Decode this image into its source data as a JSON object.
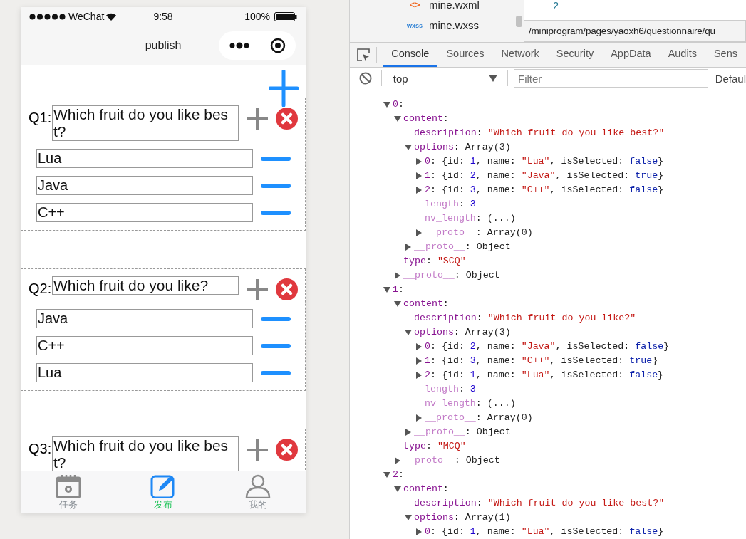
{
  "phone": {
    "status_bar": {
      "carrier": "WeChat",
      "time": "9:58",
      "battery": "100%"
    },
    "nav_title": "publish",
    "questions": [
      {
        "label": "Q1:",
        "description": "Which fruit do you like best?",
        "options": [
          "Lua",
          "Java",
          "C++"
        ]
      },
      {
        "label": "Q2:",
        "description": "Which fruit do you like?",
        "options": [
          "Java",
          "C++",
          "Lua"
        ]
      },
      {
        "label": "Q3:",
        "description": "Which fruit do you like best?"
      }
    ],
    "tab_bar": [
      {
        "kind": "tasks",
        "label": "任务",
        "selected": false
      },
      {
        "kind": "publish",
        "label": "发布",
        "selected": true
      },
      {
        "kind": "profile",
        "label": "我的",
        "selected": false
      }
    ]
  },
  "devtools": {
    "files": [
      {
        "kind": "wxml",
        "badge": "<>",
        "name": "mine.wxml"
      },
      {
        "kind": "wxss",
        "badge": "wxss",
        "name": "mine.wxss"
      }
    ],
    "editor_line_number": "2",
    "tooltip": "/miniprogram/pages/yaoxh6/questionnaire/qu",
    "tabs": [
      {
        "label": "Console",
        "selected": true
      },
      {
        "label": "Sources",
        "selected": false
      },
      {
        "label": "Network",
        "selected": false
      },
      {
        "label": "Security",
        "selected": false
      },
      {
        "label": "AppData",
        "selected": false
      },
      {
        "label": "Audits",
        "selected": false
      },
      {
        "label": "Sens",
        "selected": false
      }
    ],
    "context": "top",
    "filter": {
      "placeholder": "Filter"
    },
    "levels": "Defaul",
    "console": [
      {
        "kind": "toggle",
        "expanded": true,
        "tokens": [
          {
            "kind": "key",
            "text": "0"
          },
          {
            "kind": "plain",
            "text": ":"
          }
        ],
        "children": [
          {
            "kind": "toggle",
            "expanded": true,
            "tokens": [
              {
                "kind": "key",
                "text": "content"
              },
              {
                "kind": "plain",
                "text": ":"
              }
            ],
            "children": [
              {
                "kind": "leaf",
                "tokens": [
                  {
                    "kind": "key",
                    "text": "description"
                  },
                  {
                    "kind": "plain",
                    "text": ": "
                  },
                  {
                    "kind": "string",
                    "text": "\"Which fruit do you like best?\""
                  }
                ]
              },
              {
                "kind": "toggle",
                "expanded": true,
                "tokens": [
                  {
                    "kind": "key",
                    "text": "options"
                  },
                  {
                    "kind": "plain",
                    "text": ": Array(3)"
                  }
                ],
                "children": [
                  {
                    "kind": "toggle",
                    "expanded": false,
                    "tokens": [
                      {
                        "kind": "key",
                        "text": "0"
                      },
                      {
                        "kind": "plain",
                        "text": ": {id: "
                      },
                      {
                        "kind": "number",
                        "text": "1"
                      },
                      {
                        "kind": "plain",
                        "text": ", name: "
                      },
                      {
                        "kind": "string",
                        "text": "\"Lua\""
                      },
                      {
                        "kind": "plain",
                        "text": ", isSelected: "
                      },
                      {
                        "kind": "bool",
                        "text": "false"
                      },
                      {
                        "kind": "plain",
                        "text": "}"
                      }
                    ]
                  },
                  {
                    "kind": "toggle",
                    "expanded": false,
                    "tokens": [
                      {
                        "kind": "key",
                        "text": "1"
                      },
                      {
                        "kind": "plain",
                        "text": ": {id: "
                      },
                      {
                        "kind": "number",
                        "text": "2"
                      },
                      {
                        "kind": "plain",
                        "text": ", name: "
                      },
                      {
                        "kind": "string",
                        "text": "\"Java\""
                      },
                      {
                        "kind": "plain",
                        "text": ", isSelected: "
                      },
                      {
                        "kind": "bool",
                        "text": "true"
                      },
                      {
                        "kind": "plain",
                        "text": "}"
                      }
                    ]
                  },
                  {
                    "kind": "toggle",
                    "expanded": false,
                    "tokens": [
                      {
                        "kind": "key",
                        "text": "2"
                      },
                      {
                        "kind": "plain",
                        "text": ": {id: "
                      },
                      {
                        "kind": "number",
                        "text": "3"
                      },
                      {
                        "kind": "plain",
                        "text": ", name: "
                      },
                      {
                        "kind": "string",
                        "text": "\"C++\""
                      },
                      {
                        "kind": "plain",
                        "text": ", isSelected: "
                      },
                      {
                        "kind": "bool",
                        "text": "false"
                      },
                      {
                        "kind": "plain",
                        "text": "}"
                      }
                    ]
                  },
                  {
                    "kind": "leaf",
                    "tokens": [
                      {
                        "kind": "dim",
                        "text": "length"
                      },
                      {
                        "kind": "plain",
                        "text": ": "
                      },
                      {
                        "kind": "number",
                        "text": "3"
                      }
                    ]
                  },
                  {
                    "kind": "leaf",
                    "tokens": [
                      {
                        "kind": "dim",
                        "text": "nv_length"
                      },
                      {
                        "kind": "plain",
                        "text": ": (...)"
                      }
                    ]
                  },
                  {
                    "kind": "toggle",
                    "expanded": false,
                    "tokens": [
                      {
                        "kind": "dim",
                        "text": "__proto__"
                      },
                      {
                        "kind": "plain",
                        "text": ": Array(0)"
                      }
                    ]
                  }
                ]
              },
              {
                "kind": "toggle",
                "expanded": false,
                "tokens": [
                  {
                    "kind": "dim",
                    "text": "__proto__"
                  },
                  {
                    "kind": "plain",
                    "text": ": Object"
                  }
                ]
              }
            ]
          },
          {
            "kind": "leaf",
            "tokens": [
              {
                "kind": "key",
                "text": "type"
              },
              {
                "kind": "plain",
                "text": ": "
              },
              {
                "kind": "string",
                "text": "\"SCQ\""
              }
            ]
          },
          {
            "kind": "toggle",
            "expanded": false,
            "tokens": [
              {
                "kind": "dim",
                "text": "__proto__"
              },
              {
                "kind": "plain",
                "text": ": Object"
              }
            ]
          }
        ]
      },
      {
        "kind": "toggle",
        "expanded": true,
        "tokens": [
          {
            "kind": "key",
            "text": "1"
          },
          {
            "kind": "plain",
            "text": ":"
          }
        ],
        "children": [
          {
            "kind": "toggle",
            "expanded": true,
            "tokens": [
              {
                "kind": "key",
                "text": "content"
              },
              {
                "kind": "plain",
                "text": ":"
              }
            ],
            "children": [
              {
                "kind": "leaf",
                "tokens": [
                  {
                    "kind": "key",
                    "text": "description"
                  },
                  {
                    "kind": "plain",
                    "text": ": "
                  },
                  {
                    "kind": "string",
                    "text": "\"Which fruit do you like?\""
                  }
                ]
              },
              {
                "kind": "toggle",
                "expanded": true,
                "tokens": [
                  {
                    "kind": "key",
                    "text": "options"
                  },
                  {
                    "kind": "plain",
                    "text": ": Array(3)"
                  }
                ],
                "children": [
                  {
                    "kind": "toggle",
                    "expanded": false,
                    "tokens": [
                      {
                        "kind": "key",
                        "text": "0"
                      },
                      {
                        "kind": "plain",
                        "text": ": {id: "
                      },
                      {
                        "kind": "number",
                        "text": "2"
                      },
                      {
                        "kind": "plain",
                        "text": ", name: "
                      },
                      {
                        "kind": "string",
                        "text": "\"Java\""
                      },
                      {
                        "kind": "plain",
                        "text": ", isSelected: "
                      },
                      {
                        "kind": "bool",
                        "text": "false"
                      },
                      {
                        "kind": "plain",
                        "text": "}"
                      }
                    ]
                  },
                  {
                    "kind": "toggle",
                    "expanded": false,
                    "tokens": [
                      {
                        "kind": "key",
                        "text": "1"
                      },
                      {
                        "kind": "plain",
                        "text": ": {id: "
                      },
                      {
                        "kind": "number",
                        "text": "3"
                      },
                      {
                        "kind": "plain",
                        "text": ", name: "
                      },
                      {
                        "kind": "string",
                        "text": "\"C++\""
                      },
                      {
                        "kind": "plain",
                        "text": ", isSelected: "
                      },
                      {
                        "kind": "bool",
                        "text": "true"
                      },
                      {
                        "kind": "plain",
                        "text": "}"
                      }
                    ]
                  },
                  {
                    "kind": "toggle",
                    "expanded": false,
                    "tokens": [
                      {
                        "kind": "key",
                        "text": "2"
                      },
                      {
                        "kind": "plain",
                        "text": ": {id: "
                      },
                      {
                        "kind": "number",
                        "text": "1"
                      },
                      {
                        "kind": "plain",
                        "text": ", name: "
                      },
                      {
                        "kind": "string",
                        "text": "\"Lua\""
                      },
                      {
                        "kind": "plain",
                        "text": ", isSelected: "
                      },
                      {
                        "kind": "bool",
                        "text": "false"
                      },
                      {
                        "kind": "plain",
                        "text": "}"
                      }
                    ]
                  },
                  {
                    "kind": "leaf",
                    "tokens": [
                      {
                        "kind": "dim",
                        "text": "length"
                      },
                      {
                        "kind": "plain",
                        "text": ": "
                      },
                      {
                        "kind": "number",
                        "text": "3"
                      }
                    ]
                  },
                  {
                    "kind": "leaf",
                    "tokens": [
                      {
                        "kind": "dim",
                        "text": "nv_length"
                      },
                      {
                        "kind": "plain",
                        "text": ": (...)"
                      }
                    ]
                  },
                  {
                    "kind": "toggle",
                    "expanded": false,
                    "tokens": [
                      {
                        "kind": "dim",
                        "text": "__proto__"
                      },
                      {
                        "kind": "plain",
                        "text": ": Array(0)"
                      }
                    ]
                  }
                ]
              },
              {
                "kind": "toggle",
                "expanded": false,
                "tokens": [
                  {
                    "kind": "dim",
                    "text": "__proto__"
                  },
                  {
                    "kind": "plain",
                    "text": ": Object"
                  }
                ]
              }
            ]
          },
          {
            "kind": "leaf",
            "tokens": [
              {
                "kind": "key",
                "text": "type"
              },
              {
                "kind": "plain",
                "text": ": "
              },
              {
                "kind": "string",
                "text": "\"MCQ\""
              }
            ]
          },
          {
            "kind": "toggle",
            "expanded": false,
            "tokens": [
              {
                "kind": "dim",
                "text": "__proto__"
              },
              {
                "kind": "plain",
                "text": ": Object"
              }
            ]
          }
        ]
      },
      {
        "kind": "toggle",
        "expanded": true,
        "tokens": [
          {
            "kind": "key",
            "text": "2"
          },
          {
            "kind": "plain",
            "text": ":"
          }
        ],
        "children": [
          {
            "kind": "toggle",
            "expanded": true,
            "tokens": [
              {
                "kind": "key",
                "text": "content"
              },
              {
                "kind": "plain",
                "text": ":"
              }
            ],
            "children": [
              {
                "kind": "leaf",
                "tokens": [
                  {
                    "kind": "key",
                    "text": "description"
                  },
                  {
                    "kind": "plain",
                    "text": ": "
                  },
                  {
                    "kind": "string",
                    "text": "\"Which fruit do you like best?\""
                  }
                ]
              },
              {
                "kind": "toggle",
                "expanded": true,
                "tokens": [
                  {
                    "kind": "key",
                    "text": "options"
                  },
                  {
                    "kind": "plain",
                    "text": ": Array(1)"
                  }
                ],
                "children": [
                  {
                    "kind": "toggle",
                    "expanded": false,
                    "tokens": [
                      {
                        "kind": "key",
                        "text": "0"
                      },
                      {
                        "kind": "plain",
                        "text": ": {id: "
                      },
                      {
                        "kind": "number",
                        "text": "1"
                      },
                      {
                        "kind": "plain",
                        "text": ", name: "
                      },
                      {
                        "kind": "string",
                        "text": "\"Lua\""
                      },
                      {
                        "kind": "plain",
                        "text": ", isSelected: "
                      },
                      {
                        "kind": "bool",
                        "text": "false"
                      },
                      {
                        "kind": "plain",
                        "text": "}"
                      }
                    ]
                  }
                ]
              }
            ]
          }
        ]
      }
    ]
  }
}
